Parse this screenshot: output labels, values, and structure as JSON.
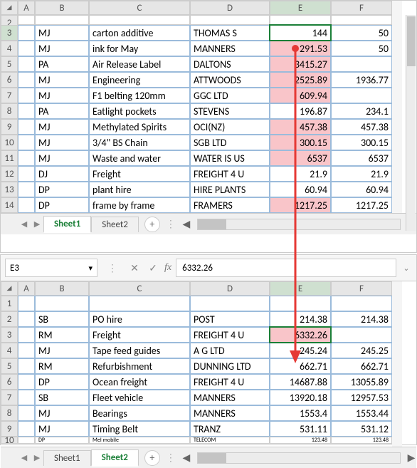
{
  "top": {
    "sheets": [
      "Sheet1",
      "Sheet2"
    ],
    "active_sheet": 0,
    "columns": [
      "A",
      "B",
      "C",
      "D",
      "E",
      "F"
    ],
    "row_start": 2,
    "selected_cell": "E3",
    "rows": [
      {
        "n": 2,
        "A": "",
        "B": "",
        "C": "",
        "D": "",
        "E": "",
        "F": "",
        "short": true
      },
      {
        "n": 3,
        "A": "",
        "B": "MJ",
        "C": "carton additive",
        "D": "THOMAS S",
        "E": "144",
        "F": "50"
      },
      {
        "n": 4,
        "A": "",
        "B": "MJ",
        "C": "ink for May",
        "D": "MANNERS",
        "E": "291.53",
        "F": "50",
        "hl": true
      },
      {
        "n": 5,
        "A": "",
        "B": "PA",
        "C": "Air Release Label",
        "D": "DALTONS",
        "E": "3415.27",
        "F": "",
        "hl": true
      },
      {
        "n": 6,
        "A": "",
        "B": "MJ",
        "C": "Engineering",
        "D": "ATTWOODS",
        "E": "2525.89",
        "F": "1936.77",
        "hl": true
      },
      {
        "n": 7,
        "A": "",
        "B": "MJ",
        "C": "F1 belting 120mm",
        "D": "GGC LTD",
        "E": "609.94",
        "F": "",
        "hl": true
      },
      {
        "n": 8,
        "A": "",
        "B": "PA",
        "C": "Eatlight pockets",
        "D": "STEVENS",
        "E": "196.87",
        "F": "234.1"
      },
      {
        "n": 9,
        "A": "",
        "B": "MJ",
        "C": "Methylated Spirits",
        "D": "OCI(NZ)",
        "E": "457.38",
        "F": "457.38",
        "hl": true
      },
      {
        "n": 10,
        "A": "",
        "B": "MJ",
        "C": "3/4\" BS Chain",
        "D": "SGB LTD",
        "E": "300.15",
        "F": "300.15",
        "hl": true
      },
      {
        "n": 11,
        "A": "",
        "B": "MJ",
        "C": "Waste and water",
        "D": "WATER IS US",
        "E": "6537",
        "F": "6537",
        "hl": true
      },
      {
        "n": 12,
        "A": "",
        "B": "DJ",
        "C": "Freight",
        "D": "FREIGHT 4 U",
        "E": "21.9",
        "F": "21.9"
      },
      {
        "n": 13,
        "A": "",
        "B": "DP",
        "C": "plant hire",
        "D": "HIRE PLANTS",
        "E": "60.94",
        "F": "60.94"
      },
      {
        "n": 14,
        "A": "",
        "B": "DP",
        "C": "frame by frame",
        "D": "FRAMERS",
        "E": "1217.25",
        "F": "1217.25",
        "hl": true
      }
    ]
  },
  "bottom": {
    "sheets": [
      "Sheet1",
      "Sheet2"
    ],
    "active_sheet": 1,
    "namebox": "E3",
    "formula_value": "6332.26",
    "columns": [
      "A",
      "B",
      "C",
      "D",
      "E",
      "F"
    ],
    "row_start": 1,
    "selected_cell": "E3",
    "rows": [
      {
        "n": 1,
        "A": "",
        "B": "",
        "C": "",
        "D": "",
        "E": "",
        "F": ""
      },
      {
        "n": 2,
        "A": "",
        "B": "SB",
        "C": "PO hire",
        "D": "POST",
        "E": "214.38",
        "F": "214.38"
      },
      {
        "n": 3,
        "A": "",
        "B": "RM",
        "C": "Freight",
        "D": "FREIGHT 4 U",
        "E": "6332.26",
        "F": "",
        "hl": true,
        "sel": true
      },
      {
        "n": 4,
        "A": "",
        "B": "MJ",
        "C": "Tape feed guides",
        "D": "A G LTD",
        "E": "245.24",
        "F": "245.25"
      },
      {
        "n": 5,
        "A": "",
        "B": "RM",
        "C": "Refurbishment",
        "D": "DUNNING LTD",
        "E": "662.71",
        "F": "662.71"
      },
      {
        "n": 6,
        "A": "",
        "B": "DP",
        "C": "Ocean freight",
        "D": "FREIGHT 4 U",
        "E": "14687.88",
        "F": "13055.89"
      },
      {
        "n": 7,
        "A": "",
        "B": "SB",
        "C": "Fleet vehicle",
        "D": "MANNERS",
        "E": "13920.18",
        "F": "12957.53"
      },
      {
        "n": 8,
        "A": "",
        "B": "MJ",
        "C": "Bearings",
        "D": "MANNERS",
        "E": "1553.4",
        "F": "1553.44"
      },
      {
        "n": 9,
        "A": "",
        "B": "MJ",
        "C": "Timing Belt",
        "D": "TRANZ",
        "E": "531.11",
        "F": "531.12"
      },
      {
        "n": 10,
        "A": "",
        "B": "DP",
        "C": "Mel mobile",
        "D": "TELECOM",
        "E": "123.48",
        "F": "123.48",
        "short": true
      }
    ]
  },
  "chart_data": null
}
